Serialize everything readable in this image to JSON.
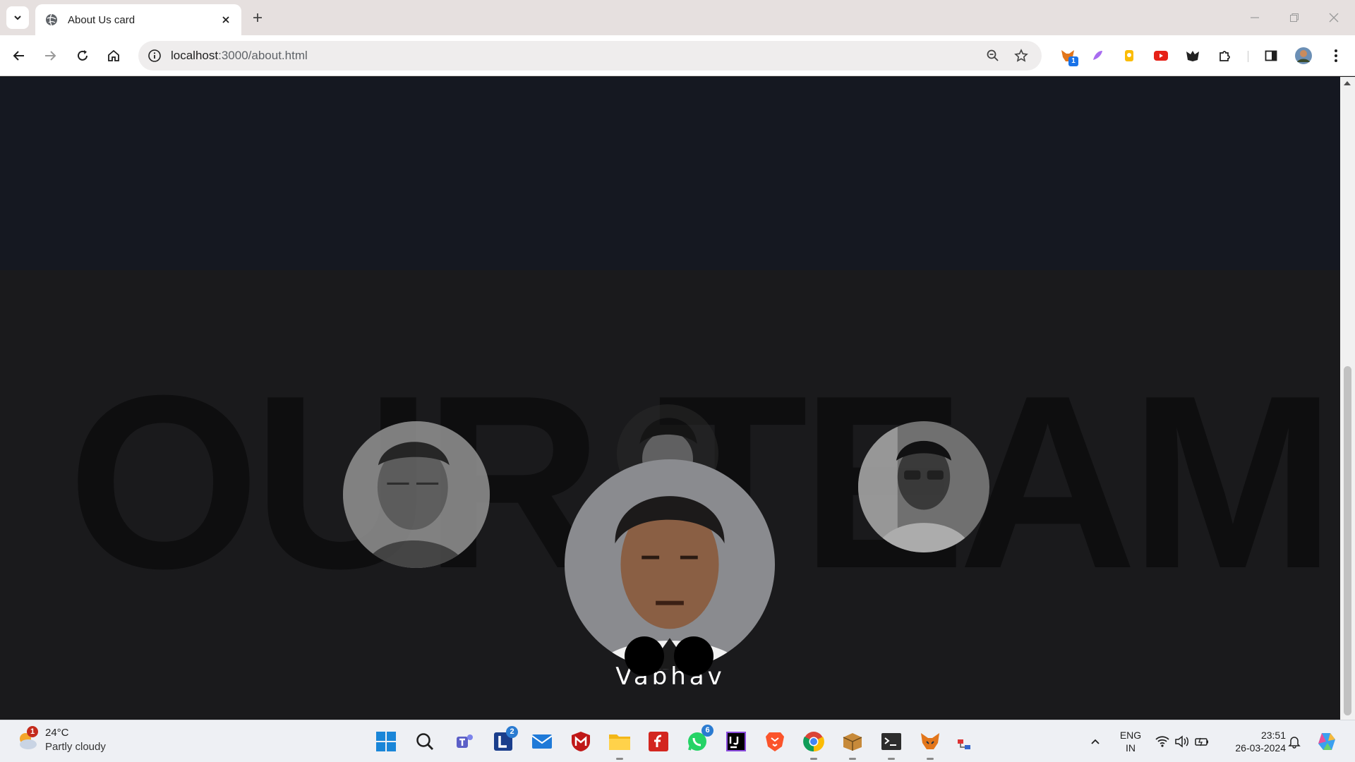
{
  "browser": {
    "tab_title": "About Us card",
    "url_host": "localhost",
    "url_rest": ":3000/about.html",
    "extension_badge": "1"
  },
  "page": {
    "background_word": "OUR TEAM",
    "member_name": "Vabhav",
    "colors": {
      "hero": "#151821",
      "section": "#1a1a1c",
      "word": "#0e0e0f"
    }
  },
  "taskbar": {
    "weather_temp": "24°C",
    "weather_cond": "Partly cloudy",
    "weather_badge": "1",
    "mail_badge": "2",
    "whatsapp_badge": "6",
    "lang_top": "ENG",
    "lang_bottom": "IN",
    "time": "23:51",
    "date": "26-03-2024"
  }
}
